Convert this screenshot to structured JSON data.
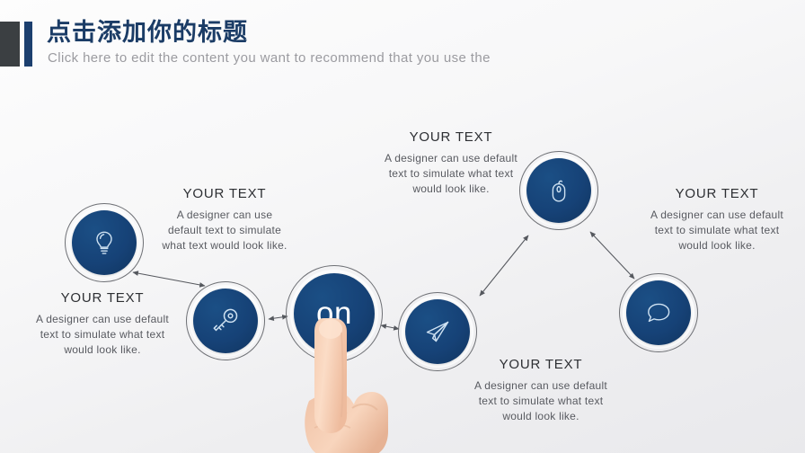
{
  "slide": {
    "title": "点击添加你的标题",
    "subtitle": "Click here to edit the content you want to recommend that you use the",
    "accent_dark": "#3b3f42",
    "accent_blue": "#1c3f6e",
    "node_navy": "#164277",
    "background": "#f5f5f7"
  },
  "center_node": {
    "label": "on",
    "icon": "power-on-button"
  },
  "nodes": [
    {
      "id": "bulb",
      "icon": "lightbulb-icon",
      "icon_name": "lightbulb"
    },
    {
      "id": "key",
      "icon": "key-icon",
      "icon_name": "key"
    },
    {
      "id": "plane",
      "icon": "paper-plane-icon",
      "icon_name": "paper-plane"
    },
    {
      "id": "mouse",
      "icon": "computer-mouse-icon",
      "icon_name": "computer-mouse"
    },
    {
      "id": "chat",
      "icon": "speech-bubble-icon",
      "icon_name": "speech-bubble"
    }
  ],
  "text_blocks": [
    {
      "id": "left",
      "title": "YOUR TEXT",
      "body": "A designer can use default text to simulate what text would look like."
    },
    {
      "id": "bulb",
      "title": "YOUR TEXT",
      "body": "A designer can use default text to simulate what text would look like."
    },
    {
      "id": "mouse",
      "title": "YOUR TEXT",
      "body": "A designer can use default text to simulate what text would look like."
    },
    {
      "id": "plane",
      "title": "YOUR TEXT",
      "body": "A designer can use default text to simulate what text would look like."
    },
    {
      "id": "chat",
      "title": "YOUR TEXT",
      "body": "A designer can use default text to simulate what text would look like."
    }
  ],
  "decor": {
    "hand": "pointing-hand-finger",
    "connector_style": "double-headed-arrow"
  }
}
